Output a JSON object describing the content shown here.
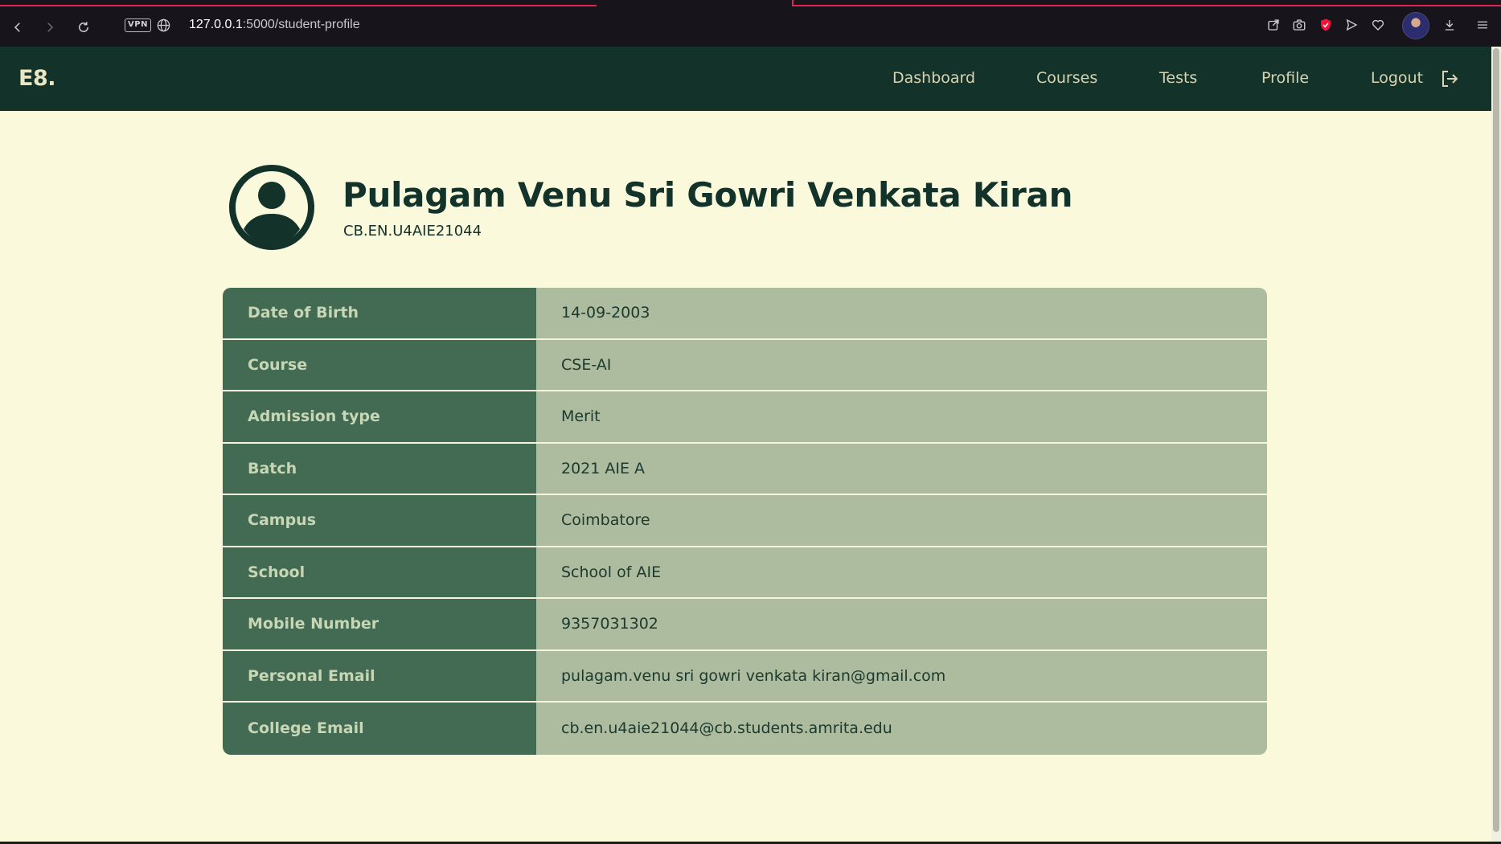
{
  "browser": {
    "url_host": "127.0.0.1",
    "url_path": ":5000/student-profile",
    "vpn_label": "VPN"
  },
  "navbar": {
    "brand": "E8.",
    "links": [
      "Dashboard",
      "Courses",
      "Tests",
      "Profile",
      "Logout"
    ]
  },
  "profile": {
    "name": "Pulagam Venu Sri Gowri Venkata Kiran",
    "roll_number": "CB.EN.U4AIE21044",
    "fields": [
      {
        "label": "Date of Birth",
        "value": "14-09-2003"
      },
      {
        "label": "Course",
        "value": "CSE-AI"
      },
      {
        "label": "Admission type",
        "value": "Merit"
      },
      {
        "label": "Batch",
        "value": "2021 AIE A"
      },
      {
        "label": "Campus",
        "value": "Coimbatore"
      },
      {
        "label": "School",
        "value": "School of AIE"
      },
      {
        "label": "Mobile Number",
        "value": "9357031302"
      },
      {
        "label": "Personal Email",
        "value": "pulagam.venu sri gowri venkata kiran@gmail.com"
      },
      {
        "label": "College Email",
        "value": "cb.en.u4aie21044@cb.students.amrita.edu"
      }
    ]
  },
  "colors": {
    "nav_bg": "#12322a",
    "page_bg": "#fbf9dc",
    "key_cell": "#436a52",
    "value_cell": "#adbb9e",
    "accent": "#e0244d"
  }
}
